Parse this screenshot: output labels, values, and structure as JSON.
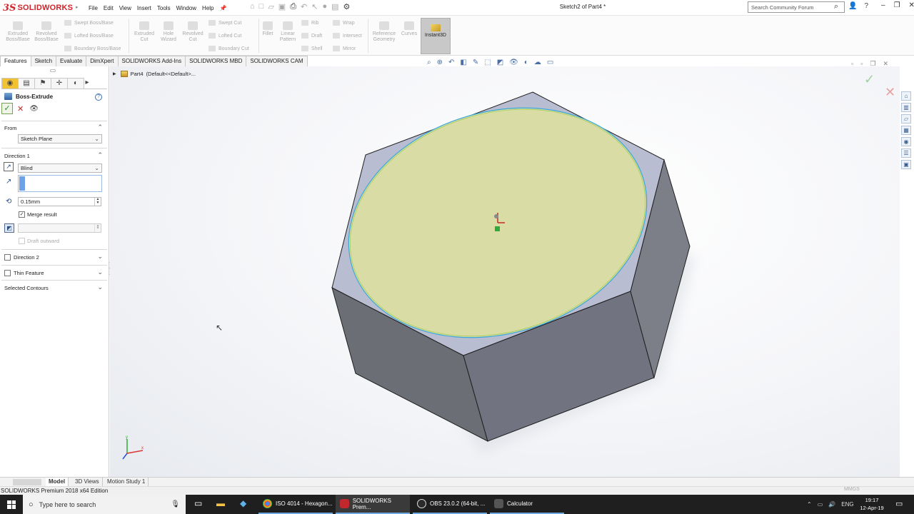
{
  "app": {
    "logo_ds": "3S",
    "logo_text": "SOLIDWORKS",
    "doc_title": "Sketch2 of Part4 *"
  },
  "menu": [
    "File",
    "Edit",
    "View",
    "Insert",
    "Tools",
    "Window",
    "Help"
  ],
  "search": {
    "placeholder": "Search Community Forum"
  },
  "commands": {
    "extruded_boss": "Extruded Boss/Base",
    "revolved_boss": "Revolved Boss/Base",
    "swept_boss": "Swept Boss/Base",
    "lofted_boss": "Lofted Boss/Base",
    "boundary_boss": "Boundary Boss/Base",
    "extruded_cut": "Extruded Cut",
    "hole_wizard": "Hole Wizard",
    "revolved_cut": "Revolved Cut",
    "swept_cut": "Swept Cut",
    "lofted_cut": "Lofted Cut",
    "boundary_cut": "Boundary Cut",
    "fillet": "Fillet",
    "linear_pattern": "Linear Pattern",
    "rib": "Rib",
    "draft": "Draft",
    "shell": "Shell",
    "wrap": "Wrap",
    "intersect": "Intersect",
    "mirror": "Mirror",
    "reference_geometry": "Reference Geometry",
    "curves": "Curves",
    "instant3d": "Instant3D"
  },
  "tabs": [
    "Features",
    "Sketch",
    "Evaluate",
    "DimXpert",
    "SOLIDWORKS Add-Ins",
    "SOLIDWORKS MBD",
    "SOLIDWORKS CAM"
  ],
  "property_manager": {
    "title": "Boss-Extrude",
    "from_label": "From",
    "from_value": "Sketch Plane",
    "direction1_label": "Direction 1",
    "end_condition": "Blind",
    "depth": "0.15mm",
    "merge_result": "Merge result",
    "draft_outward": "Draft outward",
    "direction2": "Direction 2",
    "thin_feature": "Thin Feature",
    "selected_contours": "Selected Contours"
  },
  "tree": {
    "part": "Part4",
    "config": "(Default<<Default>..."
  },
  "bottom_tabs": [
    "Model",
    "3D Views",
    "Motion Study 1"
  ],
  "status": "SOLIDWORKS Premium 2018 x64 Edition",
  "units": "MMGS",
  "taskbar": {
    "search_placeholder": "Type here to search",
    "apps": [
      "ISO 4014 - Hexagon...",
      "SOLIDWORKS Prem...",
      "OBS 23.0.2 (64-bit, ...",
      "Calculator"
    ],
    "lang": "ENG",
    "time": "19:17",
    "date": "12-Apr-19"
  },
  "colors": {
    "brand_red": "#d2232a",
    "hex_top": "#b9bdd2",
    "hex_side_dark": "#6c6e76",
    "hex_side_light": "#7c7f88",
    "sketch_fill": "#d9dca4",
    "accent_blue": "#3c7ed6"
  }
}
